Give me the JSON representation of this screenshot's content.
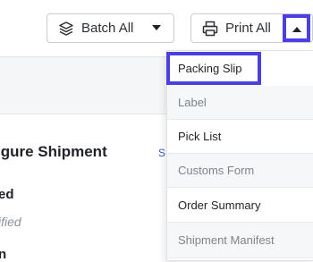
{
  "toolbar": {
    "batch_label": "Batch All",
    "print_label": "Print All"
  },
  "background": {
    "heading": "igure Shipment",
    "link_fragment": "SI",
    "line1": "ed",
    "line2": "ified",
    "line3": "n"
  },
  "menu": {
    "items": [
      {
        "label": "Packing Slip",
        "state": "active"
      },
      {
        "label": "Label",
        "state": "disabled"
      },
      {
        "label": "Pick List",
        "state": "enabled"
      },
      {
        "label": "Customs Form",
        "state": "disabled"
      },
      {
        "label": "Order Summary",
        "state": "enabled"
      },
      {
        "label": "Shipment Manifest",
        "state": "disabled"
      }
    ]
  },
  "colors": {
    "highlight": "#4a3fe0",
    "link": "#3b63c4"
  }
}
